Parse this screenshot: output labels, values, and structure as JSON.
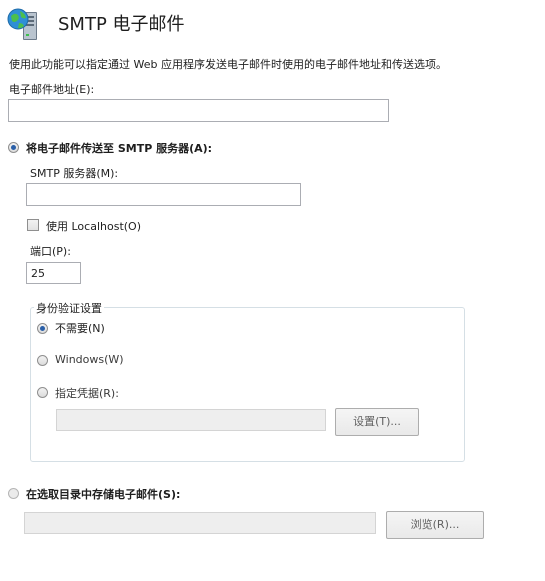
{
  "header": {
    "title": "SMTP 电子邮件",
    "icon": "globe-server-icon"
  },
  "description": "使用此功能可以指定通过 Web 应用程序发送电子邮件时使用的电子邮件地址和传送选项。",
  "email_address": {
    "label": "电子邮件地址(E):",
    "value": ""
  },
  "delivery_smtp": {
    "label": "将电子邮件传送至 SMTP 服务器(A):",
    "selected": true,
    "server": {
      "label": "SMTP 服务器(M):",
      "value": ""
    },
    "use_localhost": {
      "label": "使用 Localhost(O)",
      "checked": false
    },
    "port": {
      "label": "端口(P):",
      "value": "25"
    }
  },
  "auth": {
    "legend": "身份验证设置",
    "options": [
      {
        "label": "不需要(N)",
        "selected": true
      },
      {
        "label": "Windows(W)",
        "selected": false
      },
      {
        "label": "指定凭据(R):",
        "selected": false
      }
    ],
    "credentials_value": "",
    "settings_button": "设置(T)..."
  },
  "delivery_pickup": {
    "label": "在选取目录中存储电子邮件(S):",
    "selected": false,
    "path_value": "",
    "browse_button": "浏览(R)..."
  },
  "colors": {
    "accent_radio": "#2a5fa8",
    "border": "#abadb3",
    "disabled_bg": "#eeeeee"
  }
}
